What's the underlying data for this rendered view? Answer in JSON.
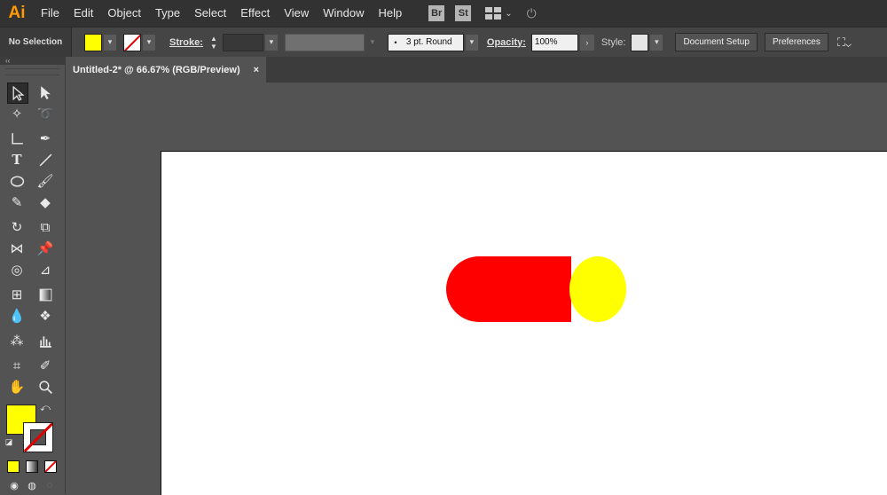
{
  "app": {
    "logo": "Ai"
  },
  "menu": [
    "File",
    "Edit",
    "Object",
    "Type",
    "Select",
    "Effect",
    "View",
    "Window",
    "Help"
  ],
  "menubar_icons": {
    "bridge": "Br",
    "stock": "St"
  },
  "control_bar": {
    "selection_state": "No Selection",
    "fill_color": "#ffff00",
    "stroke_label": "Stroke:",
    "brush_value": "3 pt. Round",
    "opacity_label": "Opacity:",
    "opacity_value": "100%",
    "style_label": "Style:",
    "document_setup": "Document Setup",
    "preferences": "Preferences"
  },
  "document_tab": {
    "title": "Untitled-2* @ 66.67% (RGB/Preview)",
    "close_glyph": "×"
  },
  "artwork": {
    "cylinder_body_color": "#ff0000",
    "cylinder_cap_color": "#ffff00"
  },
  "tools_panel": {
    "collapse_glyph": "‹‹"
  }
}
